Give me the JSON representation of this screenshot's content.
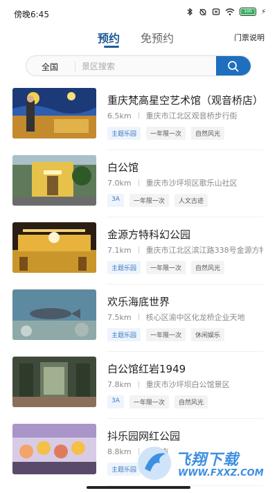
{
  "status": {
    "time": "傍晚6:45",
    "battery_level": 100,
    "battery_text": "100",
    "charge_symbol": "⚡",
    "icons": [
      "bluetooth-icon",
      "alarm-icon",
      "sim-icon",
      "wifi-icon",
      "battery-icon"
    ]
  },
  "tabs": {
    "active": "预约",
    "inactive": "免预约",
    "ticket_info": "门票说明"
  },
  "search": {
    "region": "全国",
    "placeholder": "景区搜索"
  },
  "items": [
    {
      "name": "重庆梵高星空艺术馆（观音桥店）",
      "distance": "6.5km",
      "address": "重庆市江北区观音桥步行街",
      "tags": [
        "主题乐园",
        "一年限一次",
        "自然风光"
      ],
      "first_tag_blue": true,
      "thumb": "starry"
    },
    {
      "name": "白公馆",
      "distance": "7.0km",
      "address": "重庆市沙坪坝区歌乐山社区",
      "tags": [
        "3A",
        "一年限一次",
        "人文古迹"
      ],
      "first_tag_blue": true,
      "thumb": "mansion"
    },
    {
      "name": "金源方特科幻公园",
      "distance": "7.1km",
      "address": "重庆市江北区滨江路338号金源方特",
      "tags": [
        "主题乐园",
        "一年限一次",
        "自然风光"
      ],
      "first_tag_blue": true,
      "thumb": "park"
    },
    {
      "name": "欢乐海底世界",
      "distance": "7.5km",
      "address": "核心区渝中区化龙桥企业天地",
      "tags": [
        "主题乐园",
        "一年限一次",
        "休闲娱乐"
      ],
      "first_tag_blue": true,
      "thumb": "aquarium"
    },
    {
      "name": "白公馆红岩1949",
      "distance": "7.8km",
      "address": "重庆市沙坪坝白公馆景区",
      "tags": [
        "3A",
        "一年限一次",
        "自然风光"
      ],
      "first_tag_blue": true,
      "thumb": "hall"
    },
    {
      "name": "抖乐园网红公园",
      "distance": "8.8km",
      "address": "重庆市",
      "tags": [
        "主题乐园"
      ],
      "first_tag_blue": true,
      "thumb": "fun"
    }
  ],
  "watermark": {
    "title": "飞翔下载",
    "url": "WWW.FXXZ.COM"
  }
}
